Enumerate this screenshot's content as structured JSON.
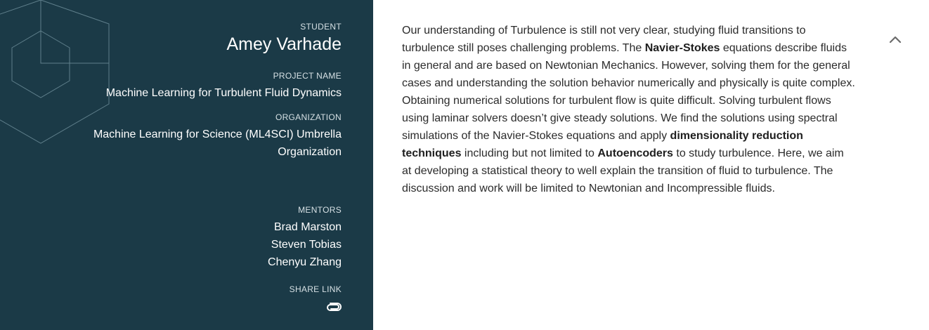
{
  "sidebar": {
    "student_label": "STUDENT",
    "student_name": "Amey Varhade",
    "project_label": "PROJECT NAME",
    "project_name": "Machine Learning for Turbulent Fluid Dynamics",
    "organization_label": "ORGANIZATION",
    "organization_name_line1": "Machine Learning for Science (ML4SCI) Umbrella",
    "organization_name_line2": "Organization",
    "mentors_label": "MENTORS",
    "mentors": [
      "Brad Marston",
      "Steven Tobias",
      "Chenyu Zhang"
    ],
    "share_label": "SHARE LINK",
    "share_icon": "link-icon",
    "background_color": "#1b3a47"
  },
  "description": {
    "segments": [
      {
        "text": "Our understanding of Turbulence is still not very clear, studying fluid transitions to turbulence still poses challenging problems. The ",
        "bold": false
      },
      {
        "text": "Navier-Stokes",
        "bold": true
      },
      {
        "text": " equations describe fluids in general and are based on Newtonian Mechanics. However, solving them for the general cases and understanding the solution behavior numerically and physically is quite complex. Obtaining numerical solutions for turbulent flow is quite difficult. Solving turbulent flows using laminar solvers doesn’t give steady solutions. We find the solutions using spectral simulations of the Navier-Stokes equations and apply ",
        "bold": false
      },
      {
        "text": "dimensionality reduction techniques",
        "bold": true
      },
      {
        "text": " including but not limited to ",
        "bold": false
      },
      {
        "text": "Autoencoders",
        "bold": true
      },
      {
        "text": " to study turbulence. Here, we aim at developing a statistical theory to well explain the transition of fluid to turbulence. The discussion and work will be limited to Newtonian and Incompressible fluids.",
        "bold": false
      }
    ]
  },
  "controls": {
    "collapse_icon": "chevron-up-icon"
  }
}
